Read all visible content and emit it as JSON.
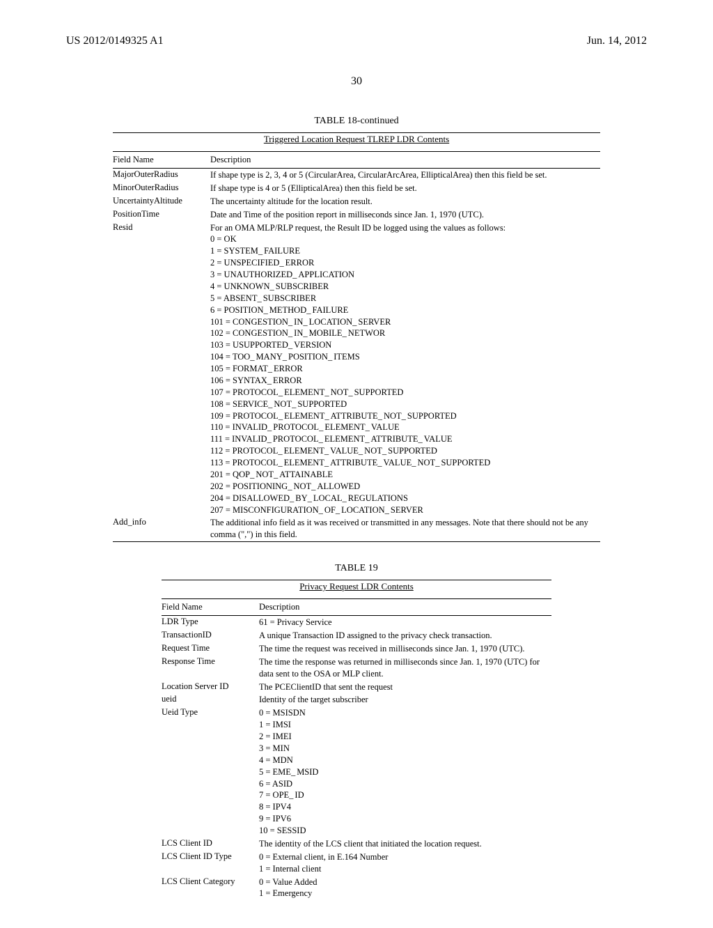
{
  "header": {
    "left": "US 2012/0149325 A1",
    "right": "Jun. 14, 2012"
  },
  "page_number": "30",
  "table18": {
    "title": "TABLE 18-continued",
    "subtitle": "Triggered Location Request TLREP LDR Contents",
    "col1": "Field Name",
    "col2": "Description",
    "rows": [
      {
        "field": "MajorOuterRadius",
        "desc": "If shape type is 2, 3, 4 or 5 (CircularArea, CircularArcArea, EllipticalArea) then this field be set."
      },
      {
        "field": "MinorOuterRadius",
        "desc": "If shape type is 4 or 5 (EllipticalArea) then this field be set."
      },
      {
        "field": "UncertaintyAltitude",
        "desc": "The uncertainty altitude for the location result."
      },
      {
        "field": "PositionTime",
        "desc": "Date and Time of the position report in milliseconds since Jan. 1, 1970 (UTC)."
      },
      {
        "field": "Resid",
        "desc": "For an OMA MLP/RLP request, the Result ID be logged using the values as follows:\n0 = OK\n1 = SYSTEM_FAILURE\n2 = UNSPECIFIED_ERROR\n3 = UNAUTHORIZED_APPLICATION\n4 = UNKNOWN_SUBSCRIBER\n5 = ABSENT_SUBSCRIBER\n6 = POSITION_METHOD_FAILURE\n101 = CONGESTION_IN_LOCATION_SERVER\n102 = CONGESTION_IN_MOBILE_NETWOR\n103 = USUPPORTED_VERSION\n104 = TOO_MANY_POSITION_ITEMS\n105 = FORMAT_ERROR\n106 = SYNTAX_ERROR\n107 = PROTOCOL_ELEMENT_NOT_SUPPORTED\n108 = SERVICE_NOT_SUPPORTED\n109 = PROTOCOL_ELEMENT_ATTRIBUTE_NOT_SUPPORTED\n110 = INVALID_PROTOCOL_ELEMENT_VALUE\n111 = INVALID_PROTOCOL_ELEMENT_ATTRIBUTE_VALUE\n112 = PROTOCOL_ELEMENT_VALUE_NOT_SUPPORTED\n113 = PROTOCOL_ELEMENT_ATTRIBUTE_VALUE_NOT_SUPPORTED\n201 = QOP_NOT_ATTAINABLE\n202 = POSITIONING_NOT_ALLOWED\n204 = DISALLOWED_BY_LOCAL_REGULATIONS\n207 = MISCONFIGURATION_OF_LOCATION_SERVER"
      },
      {
        "field": "Add_info",
        "desc": "The additional info field as it was received or transmitted in any messages. Note that there should not be any comma (\",\") in this field."
      }
    ]
  },
  "table19": {
    "title": "TABLE 19",
    "subtitle": "Privacy Request LDR Contents",
    "col1": "Field Name",
    "col2": "Description",
    "rows": [
      {
        "field": "LDR Type",
        "desc": "61 = Privacy Service"
      },
      {
        "field": "TransactionID",
        "desc": "A unique Transaction ID assigned to the privacy check transaction."
      },
      {
        "field": "Request Time",
        "desc": "The time the request was received in milliseconds since Jan. 1, 1970 (UTC)."
      },
      {
        "field": "Response Time",
        "desc": "The time the response was returned in milliseconds since Jan. 1, 1970 (UTC) for data sent to the OSA or MLP client."
      },
      {
        "field": "Location Server ID",
        "desc": "The PCEClientID that sent the request"
      },
      {
        "field": "ueid",
        "desc": "Identity of the target subscriber"
      },
      {
        "field": "Ueid Type",
        "desc": "0 = MSISDN\n1 = IMSI\n2 = IMEI\n3 = MIN\n4 = MDN\n5 = EME_MSID\n6 = ASID\n7 = OPE_ID\n8 = IPV4\n9 = IPV6\n10 = SESSID"
      },
      {
        "field": "LCS Client ID",
        "desc": "The identity of the LCS client that initiated the location request."
      },
      {
        "field": "LCS Client ID Type",
        "desc": "0 = External client, in E.164 Number\n1 = Internal client"
      },
      {
        "field": "LCS Client Category",
        "desc": "0 = Value Added\n1 = Emergency"
      }
    ]
  }
}
